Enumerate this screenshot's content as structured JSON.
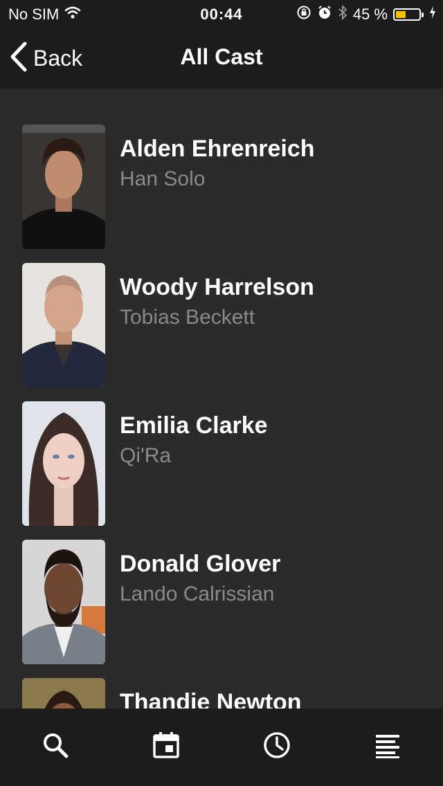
{
  "status_bar": {
    "carrier": "No SIM",
    "time": "00:44",
    "battery_percent": "45 %",
    "battery_level": 0.45,
    "icons": [
      "wifi-icon",
      "rotation-lock-icon",
      "alarm-icon",
      "bluetooth-icon",
      "battery-icon",
      "charging-icon"
    ]
  },
  "nav": {
    "back_label": "Back",
    "title": "All Cast"
  },
  "cast": [
    {
      "name": "Alden Ehrenreich",
      "role": "Han Solo"
    },
    {
      "name": "Woody Harrelson",
      "role": "Tobias Beckett"
    },
    {
      "name": "Emilia Clarke",
      "role": "Qi'Ra"
    },
    {
      "name": "Donald Glover",
      "role": "Lando Calrissian"
    },
    {
      "name": "Thandie Newton",
      "role": ""
    }
  ],
  "tab_bar": {
    "tabs": [
      "search-icon",
      "calendar-icon",
      "clock-icon",
      "list-icon"
    ]
  },
  "colors": {
    "background": "#2b2b2b",
    "bars": "#1c1c1c",
    "role_text": "#8a8a8a",
    "battery_fill": "#f2c200"
  }
}
